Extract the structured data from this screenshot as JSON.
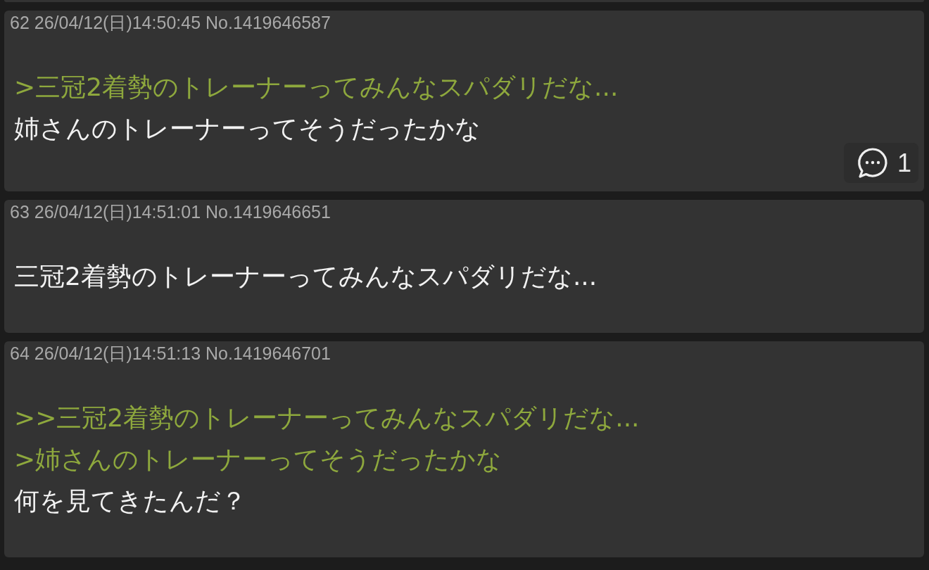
{
  "posts": [
    {
      "header": "62 26/04/12(日)14:50:45 No.1419646587",
      "lines": [
        {
          "kind": "quote",
          "text": ">三冠2着勢のトレーナーってみんなスパダリだな..."
        },
        {
          "kind": "text",
          "text": "姉さんのトレーナーってそうだったかな"
        }
      ],
      "replies": "1"
    },
    {
      "header": "63 26/04/12(日)14:51:01 No.1419646651",
      "lines": [
        {
          "kind": "text",
          "text": "三冠2着勢のトレーナーってみんなスパダリだな..."
        }
      ]
    },
    {
      "header": "64 26/04/12(日)14:51:13 No.1419646701",
      "lines": [
        {
          "kind": "quote",
          "text": ">>三冠2着勢のトレーナーってみんなスパダリだな..."
        },
        {
          "kind": "quote",
          "text": ">姉さんのトレーナーってそうだったかな"
        },
        {
          "kind": "text",
          "text": "何を見てきたんだ？"
        }
      ]
    }
  ]
}
